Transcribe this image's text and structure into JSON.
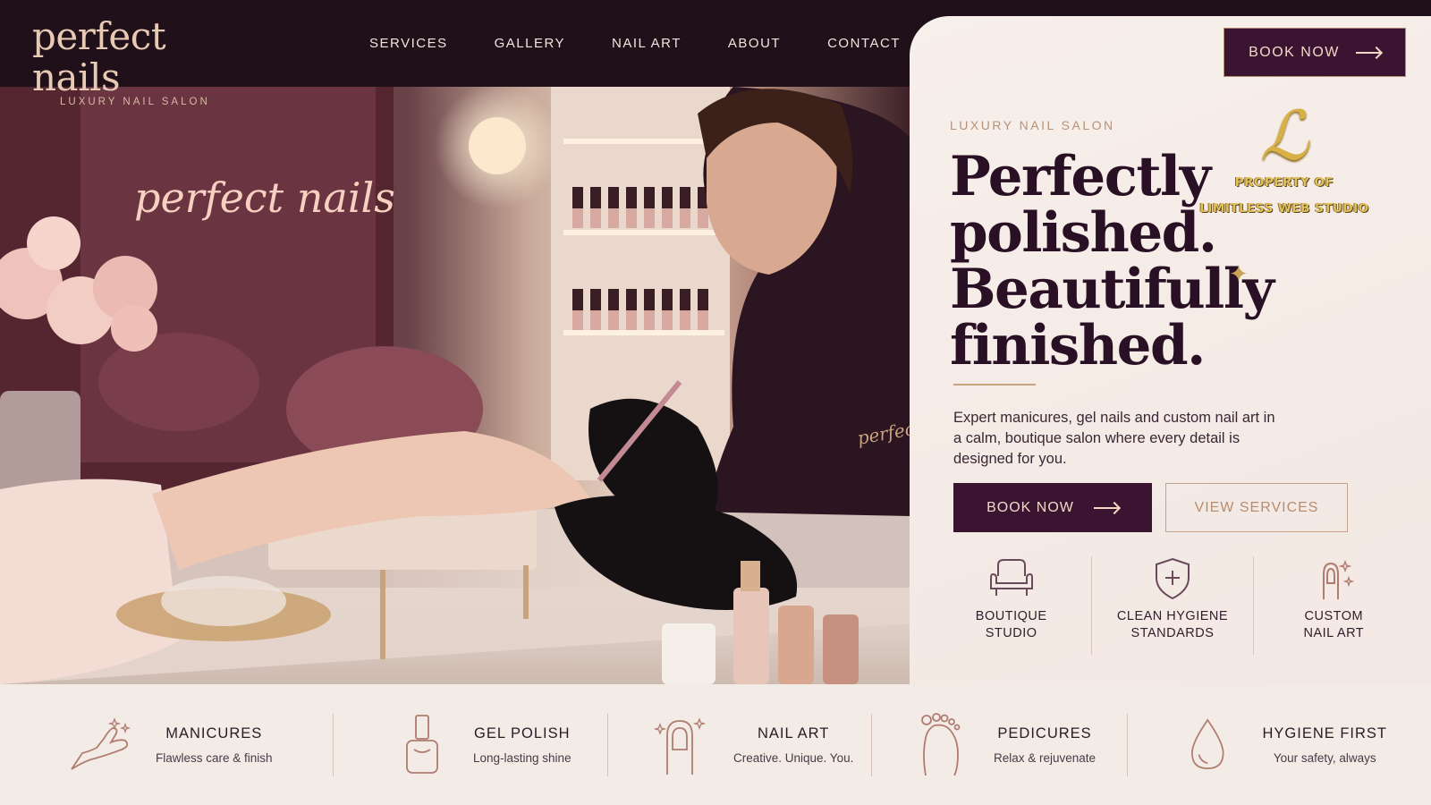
{
  "header": {
    "logo_main": "perfect nails",
    "logo_sub": "LUXURY NAIL SALON",
    "nav": [
      "SERVICES",
      "GALLERY",
      "NAIL ART",
      "ABOUT",
      "CONTACT"
    ],
    "book_label": "BOOK NOW"
  },
  "hero": {
    "neon_sign": "perfect nails",
    "shirt_logo": "perfect nails",
    "eyebrow": "LUXURY NAIL SALON",
    "headline": [
      "Perfectly",
      "polished.",
      "Beautifully",
      "finished."
    ],
    "description": "Expert manicures, gel nails and custom nail art in a calm, boutique salon where every detail is designed for you.",
    "primary_button": "BOOK NOW",
    "secondary_button": "VIEW SERVICES",
    "features": [
      {
        "icon": "armchair-icon",
        "label": "BOUTIQUE\nSTUDIO"
      },
      {
        "icon": "shield-plus-icon",
        "label": "CLEAN HYGIENE\nSTANDARDS"
      },
      {
        "icon": "nail-sparkle-icon",
        "label": "CUSTOM\nNAIL ART"
      }
    ]
  },
  "watermark": {
    "logo_mark": "ℒ",
    "line1": "PROPERTY OF",
    "line2": "LIMITLESS WEB STUDIO"
  },
  "services": [
    {
      "icon": "hand-sparkle-icon",
      "title": "MANICURES",
      "subtitle": "Flawless care & finish"
    },
    {
      "icon": "polish-bottle-icon",
      "title": "GEL POLISH",
      "subtitle": "Long-lasting shine"
    },
    {
      "icon": "nail-art-icon",
      "title": "NAIL ART",
      "subtitle": "Creative. Unique. You."
    },
    {
      "icon": "foot-icon",
      "title": "PEDICURES",
      "subtitle": "Relax & rejuvenate"
    },
    {
      "icon": "droplet-icon",
      "title": "HYGIENE FIRST",
      "subtitle": "Your safety, always"
    }
  ],
  "colors": {
    "header_bg": "#1f1019",
    "plum": "#3a1431",
    "gold": "#c9a27f",
    "cream": "#f3ebe6"
  }
}
